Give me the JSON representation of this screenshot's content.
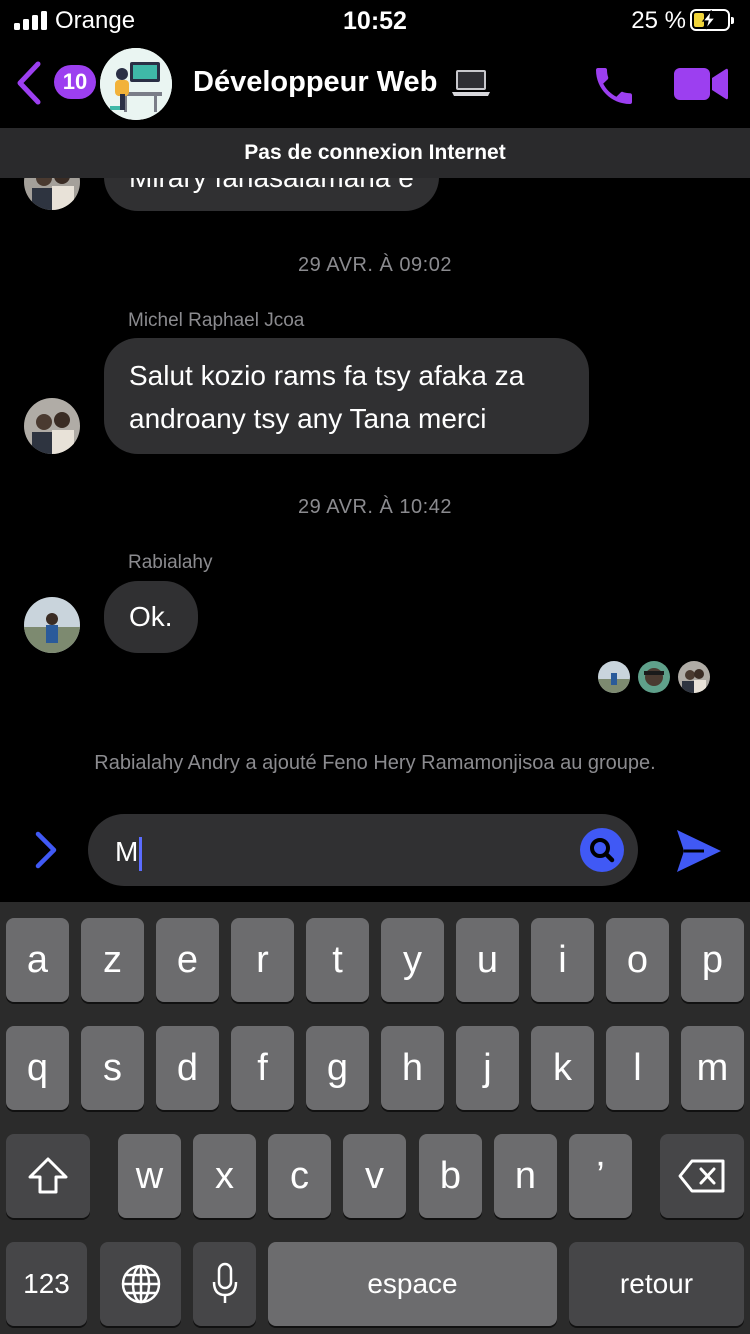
{
  "status_bar": {
    "carrier": "Orange",
    "time": "10:52",
    "battery": "25 %"
  },
  "header": {
    "unread_count": "10",
    "title": "Développeur Web"
  },
  "banner": {
    "text": "Pas de connexion Internet"
  },
  "messages": {
    "partial_text": "Mirary fahasalamana e",
    "timestamp_1": "29 AVR. À 09:02",
    "sender_1": "Michel Raphael Jcoa",
    "message_1_line1": "Salut kozio rams fa tsy afaka za",
    "message_1_line2": "androany tsy any Tana merci",
    "timestamp_2": "29 AVR. À 10:42",
    "sender_2": "Rabialahy",
    "message_2": "Ok.",
    "system": "Rabialahy Andry a ajouté Feno Hery Ramamonjisoa au groupe."
  },
  "composer": {
    "input_value": "M"
  },
  "keyboard": {
    "row1": [
      "a",
      "z",
      "e",
      "r",
      "t",
      "y",
      "u",
      "i",
      "o",
      "p"
    ],
    "row2": [
      "q",
      "s",
      "d",
      "f",
      "g",
      "h",
      "j",
      "k",
      "l",
      "m"
    ],
    "row3": [
      "w",
      "x",
      "c",
      "v",
      "b",
      "n",
      "’"
    ],
    "numbers": "123",
    "space": "espace",
    "return": "retour"
  },
  "colors": {
    "accent": "#9c3ff0",
    "send": "#4059f5",
    "bubble": "#303032"
  }
}
